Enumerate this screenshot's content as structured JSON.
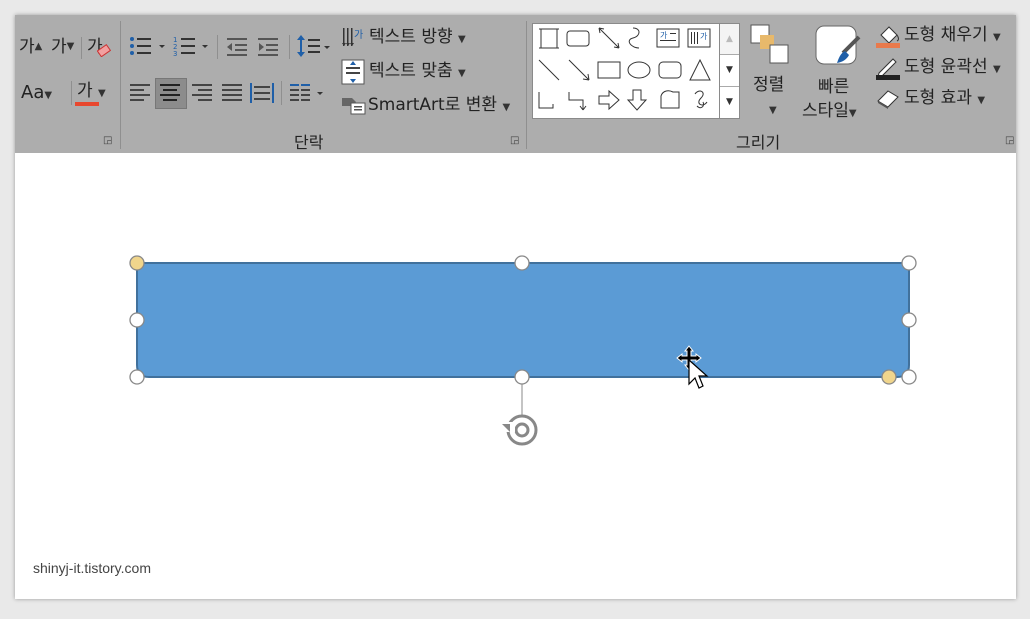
{
  "ribbon": {
    "font_group": {
      "grow_font_label": "가",
      "shrink_font_label": "가",
      "clear_format_label": "가",
      "change_case_label": "Aa",
      "font_color_label": "가",
      "font_color_hex": "#e8472e"
    },
    "paragraph_group": {
      "label": "단락",
      "text_direction_label": "텍스트 방향",
      "align_text_label": "텍스트 맞춤",
      "smartart_label": "SmartArt로 변환"
    },
    "drawing_group": {
      "label": "그리기",
      "arrange_label": "정렬",
      "quick_styles_label_line1": "빠른",
      "quick_styles_label_line2": "스타일",
      "shape_fill_label": "도형 채우기",
      "shape_outline_label": "도형 윤곽선",
      "shape_effects_label": "도형 효과",
      "fill_color_hex": "#e97a4c"
    }
  },
  "slide": {
    "shape_fill_hex": "#5b9bd5",
    "shape_border_hex": "#41719c",
    "handle_adjust_hex": "#f0d58c"
  },
  "watermark": "shinyj-it.tistory.com"
}
